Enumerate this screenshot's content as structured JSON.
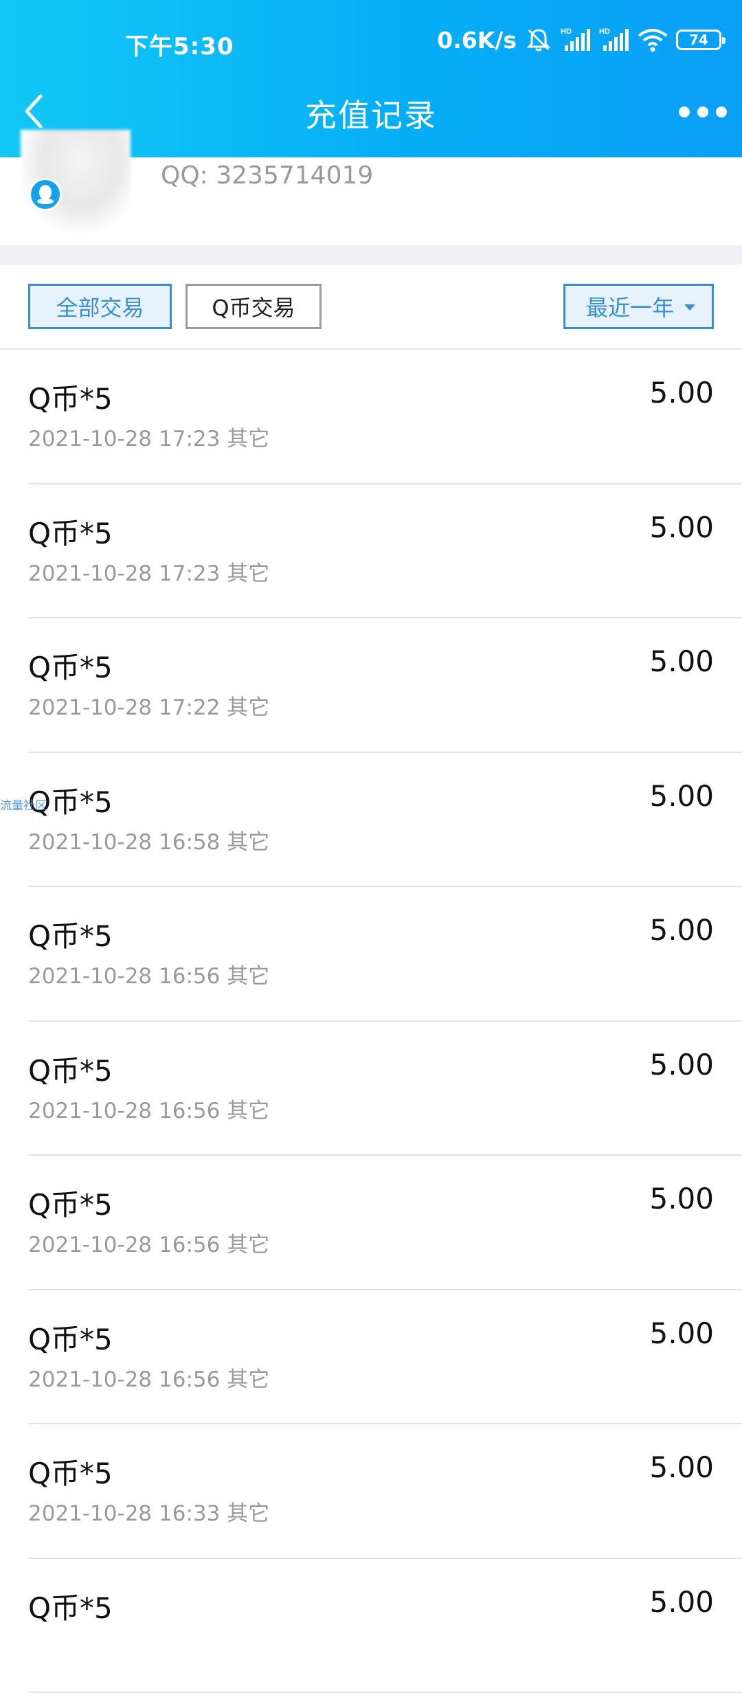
{
  "status_bar": {
    "time": "下午5:30",
    "network_speed": "0.6K/s",
    "battery": "74",
    "icons": [
      "bell-off-icon",
      "signal-hd-icon",
      "signal-hd-icon",
      "wifi-icon",
      "battery-icon"
    ]
  },
  "header": {
    "title": "充值记录",
    "back_icon": "chevron-left-icon",
    "more_icon": "more-dots-icon",
    "background_colors": [
      "#12c8f5",
      "#0a9ff7"
    ]
  },
  "profile": {
    "qq_number": "QQ: 3235714019",
    "badge_icon": "qq-penguin-icon"
  },
  "filters": {
    "all": "全部交易",
    "q_coin": "Q币交易",
    "range": "最近一年",
    "accent_color": "#3a8ed1"
  },
  "records": [
    {
      "name": "Q币*5",
      "time": "2021-10-28 17:23",
      "type": "其它",
      "amount": "5.00"
    },
    {
      "name": "Q币*5",
      "time": "2021-10-28 17:23",
      "type": "其它",
      "amount": "5.00"
    },
    {
      "name": "Q币*5",
      "time": "2021-10-28 17:22",
      "type": "其它",
      "amount": "5.00"
    },
    {
      "name": "Q币*5",
      "time": "2021-10-28 16:58",
      "type": "其它",
      "amount": "5.00"
    },
    {
      "name": "Q币*5",
      "time": "2021-10-28 16:56",
      "type": "其它",
      "amount": "5.00"
    },
    {
      "name": "Q币*5",
      "time": "2021-10-28 16:56",
      "type": "其它",
      "amount": "5.00"
    },
    {
      "name": "Q币*5",
      "time": "2021-10-28 16:56",
      "type": "其它",
      "amount": "5.00"
    },
    {
      "name": "Q币*5",
      "time": "2021-10-28 16:56",
      "type": "其它",
      "amount": "5.00"
    },
    {
      "name": "Q币*5",
      "time": "2021-10-28 16:33",
      "type": "其它",
      "amount": "5.00"
    },
    {
      "name": "Q币*5",
      "time": "",
      "type": "",
      "amount": "5.00"
    }
  ],
  "watermark": "流量社区"
}
